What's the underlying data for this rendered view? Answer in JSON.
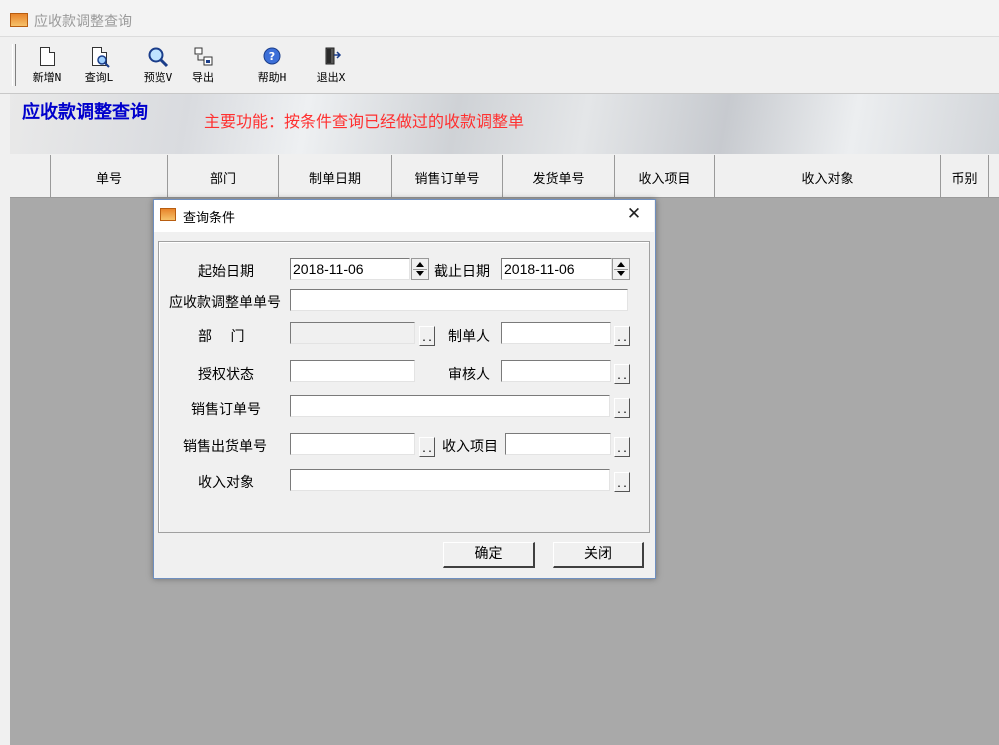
{
  "window": {
    "title": "应收款调整查询"
  },
  "toolbar": {
    "items": [
      {
        "label": "新增N",
        "icon": "new-document-icon"
      },
      {
        "label": "查询L",
        "icon": "query-document-icon"
      },
      {
        "label": "预览V",
        "icon": "magnifier-icon"
      },
      {
        "label": "导出",
        "icon": "export-icon"
      },
      {
        "label": "帮助H",
        "icon": "help-icon"
      },
      {
        "label": "退出X",
        "icon": "exit-door-icon"
      }
    ]
  },
  "banner": {
    "title": "应收款调整查询",
    "description": "主要功能：按条件查询已经做过的收款调整单"
  },
  "grid": {
    "columns": [
      "单号",
      "部门",
      "制单日期",
      "销售订单号",
      "发货单号",
      "收入项目",
      "收入对象",
      "币别"
    ]
  },
  "dialog": {
    "title": "查询条件",
    "start_date_label": "起始日期",
    "start_date_value": "2018-11-06",
    "end_date_label": "截止日期",
    "end_date_value": "2018-11-06",
    "adjust_no_label": "应收款调整单单号",
    "adjust_no_value": "",
    "department_label": "部　 门",
    "department_value": "",
    "maker_label": "制单人",
    "maker_value": "",
    "auth_status_label": "授权状态",
    "auth_status_value": "",
    "auditor_label": "审核人",
    "auditor_value": "",
    "sales_order_label": "销售订单号",
    "sales_order_value": "",
    "delivery_no_label": "销售出货单号",
    "delivery_no_value": "",
    "income_item_label": "收入项目",
    "income_item_value": "",
    "income_target_label": "收入对象",
    "income_target_value": "",
    "ellipsis": "..",
    "ok_label": "确定",
    "close_label": "关闭",
    "close_glyph": "✕"
  }
}
